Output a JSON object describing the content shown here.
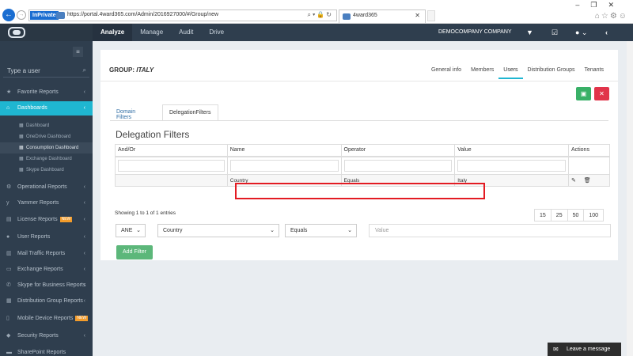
{
  "browser": {
    "inprivate": "InPrivate",
    "url": "https://portal.4ward365.com/Admin/2016927000/#/Group/new",
    "tab_title": "4ward365",
    "tab_close": "✕"
  },
  "header": {
    "nav": [
      "Analyze",
      "Manage",
      "Audit",
      "Drive"
    ],
    "company": "DEMOCOMPANY COMPANY"
  },
  "sidebar": {
    "search_placeholder": "Type a user",
    "items": [
      {
        "label": "Favorite Reports",
        "icon": "star-icon"
      },
      {
        "label": "Dashboards",
        "icon": "home-icon",
        "active": true
      },
      {
        "label": "Operational Reports",
        "icon": "gears-icon"
      },
      {
        "label": "Yammer Reports",
        "icon": "yammer-icon"
      },
      {
        "label": "License Reports",
        "icon": "license-icon",
        "badge": "NEW"
      },
      {
        "label": "User Reports",
        "icon": "user-icon"
      },
      {
        "label": "Mail Traffic Reports",
        "icon": "bar-chart-icon"
      },
      {
        "label": "Exchange Reports",
        "icon": "inbox-icon"
      },
      {
        "label": "Skype for Business Reports",
        "icon": "phone-icon"
      },
      {
        "label": "Distribution Group Reports",
        "icon": "group-icon"
      },
      {
        "label": "Mobile Device Reports",
        "icon": "mobile-icon",
        "badge": "NEW"
      },
      {
        "label": "Security Reports",
        "icon": "shield-icon"
      },
      {
        "label": "SharePoint Reports",
        "icon": "folder-icon"
      }
    ],
    "subitems": [
      "Dashboard",
      "OneDrive Dashboard",
      "Consumption Dashboard",
      "Exchange Dashboard",
      "Skype Dashboard"
    ]
  },
  "group": {
    "label": "GROUP:",
    "name": "ITALY",
    "tabs": [
      "General info",
      "Members",
      "Users",
      "Distribution Groups",
      "Tenants"
    ],
    "active_tab": "Users"
  },
  "subtabs": [
    "Domain Filters",
    "DelegationFilters"
  ],
  "section_title": "Delegation Filters",
  "table": {
    "columns": [
      "And/Or",
      "Name",
      "Operator",
      "Value",
      "Actions"
    ],
    "rows": [
      {
        "andor": "",
        "name": "Country",
        "operator": "Equals",
        "value": "Italy"
      }
    ]
  },
  "showing": "Showing 1 to 1 of 1 entries",
  "page_sizes": [
    "15",
    "25",
    "50",
    "100"
  ],
  "form": {
    "andor_value": "ANE",
    "name_value": "Country",
    "operator_value": "Equals",
    "value_placeholder": "Value",
    "add_label": "Add Filter"
  },
  "chat": {
    "label": "Leave a message"
  },
  "colors": {
    "accent": "#1fb6d1",
    "sidebar": "#2f3e4e",
    "save": "#39b067",
    "danger": "#e1344a",
    "highlight": "#e31b23"
  }
}
